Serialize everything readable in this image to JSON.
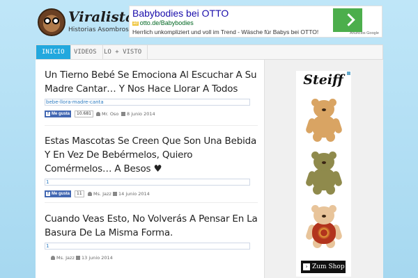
{
  "header": {
    "site_title": "Viralistas",
    "site_subtitle": "Historias Asombrosas"
  },
  "top_ad": {
    "title": "Babybodies bei OTTO",
    "badge": "ad",
    "url": "otto.de/Babybodies",
    "description": "Herrlich unkompliziert und voll im Trend - Wäsche für Babys bei OTTO!",
    "network_label": "Anuncios Google"
  },
  "nav": {
    "items": [
      {
        "label": "INICIO",
        "active": true
      },
      {
        "label": "VIDEOS",
        "active": false
      },
      {
        "label": "LO + VISTO",
        "active": false
      }
    ]
  },
  "posts": [
    {
      "title": "Un Tierno Bebé Se Emociona Al Escuchar A Su Madre Cantar… Y Nos Hace Llorar A Todos",
      "tag": "bebe-llora-madre-canta",
      "like_label": "Me gusta",
      "like_count": "10.681",
      "author": "Mr. Oso",
      "date": "8 junio 2014"
    },
    {
      "title": "Estas Mascotas Se Creen Que Son Una Bebida Y En Vez De Bebérmelos, Quiero Comérmelos… A Besos ♥",
      "tag": "1",
      "like_label": "Me gusta",
      "like_count": "11",
      "author": "Ms. Jazz",
      "date": "14 junio 2014"
    },
    {
      "title": "Cuando Veas Esto, No Volverás A Pensar En La Basura De La Misma Forma.",
      "tag": "1",
      "like_label": "",
      "like_count": "",
      "author": "Ms. Jazz",
      "date": "13 junio 2014"
    }
  ],
  "side_ad": {
    "brand": "Steiff",
    "cta": "Zum Shop",
    "cta_arrow": "›"
  },
  "colors": {
    "accent": "#22a8de",
    "background": "#b3dff4",
    "facebook": "#4267b2"
  }
}
